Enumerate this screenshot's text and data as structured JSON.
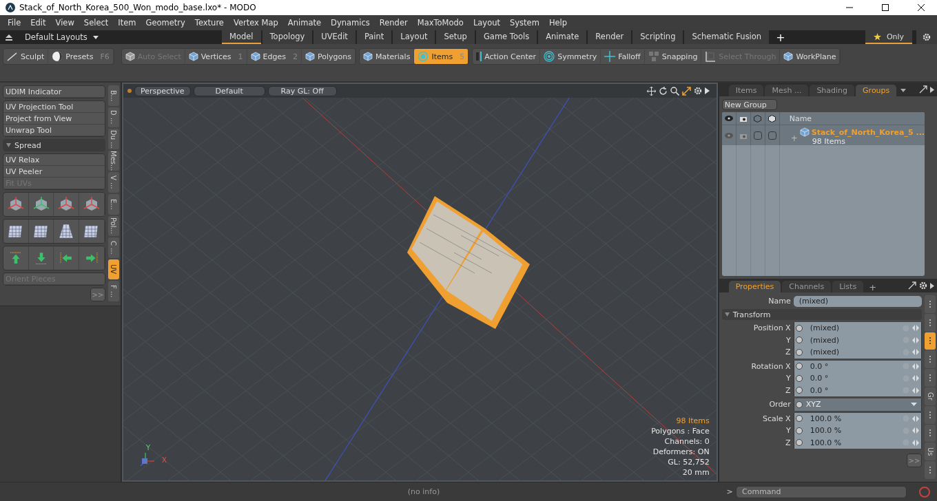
{
  "window": {
    "title": "Stack_of_North_Korea_500_Won_modo_base.lxo* - MODO"
  },
  "menu": [
    "File",
    "Edit",
    "View",
    "Select",
    "Item",
    "Geometry",
    "Texture",
    "Vertex Map",
    "Animate",
    "Dynamics",
    "Render",
    "MaxToModo",
    "Layout",
    "System",
    "Help"
  ],
  "layouts": {
    "label": "Default Layouts",
    "only": "Only",
    "tabs": [
      {
        "label": "Model",
        "selected": true
      },
      {
        "label": "Topology",
        "selected": false
      },
      {
        "label": "UVEdit",
        "selected": false
      },
      {
        "label": "Paint",
        "selected": false
      },
      {
        "label": "Layout",
        "selected": false
      },
      {
        "label": "Setup",
        "selected": false
      },
      {
        "label": "Game Tools",
        "selected": false
      },
      {
        "label": "Animate",
        "selected": false
      },
      {
        "label": "Render",
        "selected": false
      },
      {
        "label": "Scripting",
        "selected": false
      },
      {
        "label": "Schematic Fusion",
        "selected": false
      }
    ],
    "add": "+"
  },
  "toolbar": [
    {
      "buttons": [
        {
          "label": "Sculpt",
          "disabled": false,
          "selected": false
        },
        {
          "label": "Presets",
          "shortcut": "F6",
          "disabled": false,
          "selected": false
        }
      ]
    },
    {
      "buttons": [
        {
          "label": "Auto Select",
          "disabled": true,
          "selected": false
        },
        {
          "label": "Vertices",
          "shortcut": "1",
          "disabled": false,
          "selected": false
        },
        {
          "label": "Edges",
          "shortcut": "2",
          "disabled": false,
          "selected": false
        },
        {
          "label": "Polygons",
          "disabled": false,
          "selected": false
        }
      ]
    },
    {
      "buttons": [
        {
          "label": "Materials",
          "disabled": false,
          "selected": false
        },
        {
          "label": "Items",
          "shortcut": "5",
          "disabled": false,
          "selected": true
        }
      ]
    },
    {
      "buttons": [
        {
          "label": "Action Center",
          "disabled": false,
          "selected": false
        },
        {
          "label": "Symmetry",
          "disabled": false,
          "selected": false
        },
        {
          "label": "Falloff",
          "disabled": false,
          "selected": false
        },
        {
          "label": "Snapping",
          "disabled": false,
          "selected": false
        },
        {
          "label": "Select Through",
          "disabled": true,
          "selected": false
        },
        {
          "label": "WorkPlane",
          "disabled": false,
          "selected": false
        }
      ]
    }
  ],
  "tool_panel": {
    "groups": [
      {
        "kind": "list",
        "items": [
          {
            "label": "UDIM Indicator",
            "disabled": false
          }
        ]
      },
      {
        "kind": "list",
        "items": [
          {
            "label": "UV Projection Tool",
            "disabled": false
          },
          {
            "label": "Project from View",
            "disabled": false
          },
          {
            "label": "Unwrap Tool",
            "disabled": false
          }
        ]
      },
      {
        "kind": "header",
        "header": "Spread"
      },
      {
        "kind": "list",
        "items": [
          {
            "label": "UV Relax",
            "disabled": false
          },
          {
            "label": "UV Peeler",
            "disabled": false
          },
          {
            "label": "Fit UVs",
            "disabled": true
          }
        ]
      },
      {
        "kind": "icons"
      },
      {
        "kind": "icons"
      },
      {
        "kind": "icons"
      },
      {
        "kind": "list",
        "items": [
          {
            "label": "Orient Pieces",
            "disabled": true
          }
        ]
      }
    ],
    "more": ">>",
    "side_tabs": [
      {
        "label": "B...",
        "selected": false
      },
      {
        "label": "D ...",
        "selected": false
      },
      {
        "label": "Du ...",
        "selected": false
      },
      {
        "label": "Mes...",
        "selected": false
      },
      {
        "label": "V ...",
        "selected": false
      },
      {
        "label": "E...",
        "selected": false
      },
      {
        "label": "Pol...",
        "selected": false
      },
      {
        "label": "C ...",
        "selected": false
      },
      {
        "label": "UV",
        "selected": true
      },
      {
        "label": "F ...",
        "selected": false
      }
    ]
  },
  "viewport": {
    "buttons": [
      "Perspective",
      "Default",
      "Ray GL: Off"
    ],
    "stats": [
      {
        "text": "98 Items",
        "highlight": true
      },
      {
        "text": "Polygons : Face",
        "highlight": false
      },
      {
        "text": "Channels: 0",
        "highlight": false
      },
      {
        "text": "Deformers: ON",
        "highlight": false
      },
      {
        "text": "GL: 52,752",
        "highlight": false
      },
      {
        "text": "20 mm",
        "highlight": false
      }
    ],
    "axis": {
      "y": "Y",
      "x": "X"
    }
  },
  "groups_panel": {
    "tabs": [
      {
        "label": "Items",
        "selected": false
      },
      {
        "label": "Mesh ...",
        "selected": false
      },
      {
        "label": "Shading",
        "selected": false
      },
      {
        "label": "Groups",
        "selected": true
      }
    ],
    "new_group": "New Group",
    "name_header": "Name",
    "rows": [
      {
        "name": "Stack_of_North_Korea_5 ...",
        "count": "98 Items",
        "expand": "+"
      }
    ]
  },
  "properties": {
    "tabs": [
      {
        "label": "Properties",
        "selected": true
      },
      {
        "label": "Channels",
        "selected": false
      },
      {
        "label": "Lists",
        "selected": false
      }
    ],
    "add": "+",
    "name_label": "Name",
    "name_value": "(mixed)",
    "section": "Transform",
    "groups": [
      {
        "kind": "fields",
        "rows": [
          {
            "label": "Position X",
            "value": "(mixed)"
          },
          {
            "label": "Y",
            "value": "(mixed)"
          },
          {
            "label": "Z",
            "value": "(mixed)"
          }
        ]
      },
      {
        "kind": "fields",
        "rows": [
          {
            "label": "Rotation X",
            "value": "0.0 °"
          },
          {
            "label": "Y",
            "value": "0.0 °"
          },
          {
            "label": "Z",
            "value": "0.0 °"
          }
        ]
      },
      {
        "kind": "dropdown",
        "rows": [
          {
            "label": "Order",
            "value": "XYZ"
          }
        ]
      },
      {
        "kind": "fields",
        "rows": [
          {
            "label": "Scale X",
            "value": "100.0 %"
          },
          {
            "label": "Y",
            "value": "100.0 %"
          },
          {
            "label": "Z",
            "value": "100.0 %"
          }
        ]
      }
    ],
    "more": ">>",
    "side_tabs": [
      {
        "kind": "dots",
        "selected": false
      },
      {
        "kind": "dots",
        "selected": false
      },
      {
        "kind": "dots",
        "selected": true
      },
      {
        "kind": "dots",
        "selected": false
      },
      {
        "kind": "dots",
        "selected": false
      },
      {
        "kind": "text",
        "label": "Gr",
        "selected": false
      },
      {
        "kind": "dots",
        "selected": false
      },
      {
        "kind": "dots",
        "selected": false
      },
      {
        "kind": "text",
        "label": "Us",
        "selected": false
      },
      {
        "kind": "dots",
        "selected": false
      }
    ]
  },
  "status_bar": {
    "info": "(no info)",
    "prompt": ">",
    "command_placeholder": "Command"
  }
}
